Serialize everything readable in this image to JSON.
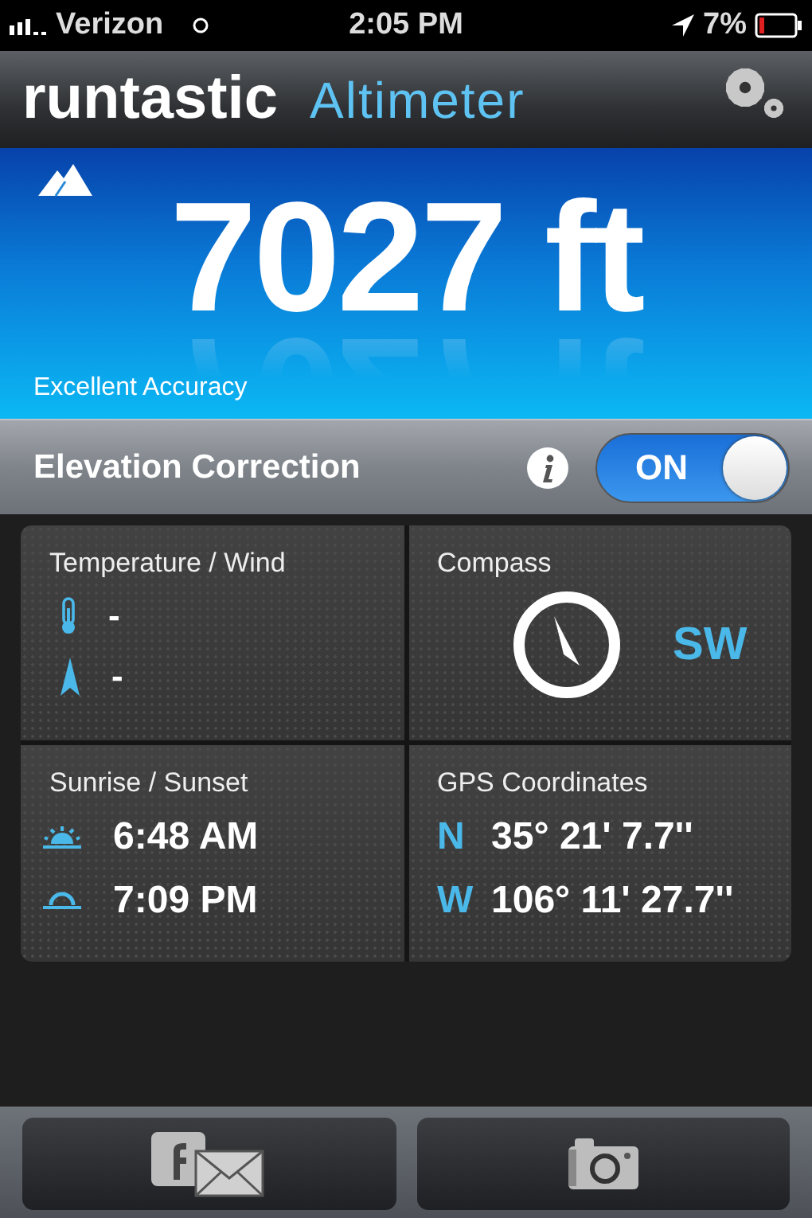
{
  "status_bar": {
    "carrier": "Verizon",
    "time": "2:05 PM",
    "battery": "7%"
  },
  "header": {
    "brand": "runtastic",
    "app": "Altimeter"
  },
  "altitude": {
    "value": "7027 ft",
    "accuracy": "Excellent Accuracy"
  },
  "elevation_correction": {
    "label": "Elevation Correction",
    "on": true,
    "toggle_label": "ON"
  },
  "panels": [
    {
      "kind": "list",
      "title": "Temperature / Wind",
      "rows": [
        {
          "kind": "thermometer",
          "value": "-"
        },
        {
          "kind": "wind",
          "value": "-"
        }
      ]
    },
    {
      "kind": "compass",
      "title": "Compass",
      "direction": "SW"
    },
    {
      "kind": "list",
      "title": "Sunrise / Sunset",
      "rows": [
        {
          "kind": "sunrise",
          "value": "6:48 AM"
        },
        {
          "kind": "sunset",
          "value": "7:09 PM"
        }
      ]
    },
    {
      "kind": "list",
      "title": "GPS Coordinates",
      "rows": [
        {
          "kind": "letter",
          "label": "N",
          "value": "35° 21' 7.7''"
        },
        {
          "kind": "letter",
          "label": "W",
          "value": "106° 11' 27.7''"
        }
      ]
    }
  ],
  "footer_buttons": [
    {
      "kind": "share"
    },
    {
      "kind": "camera"
    }
  ]
}
